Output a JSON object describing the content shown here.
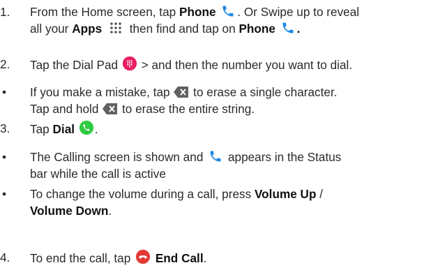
{
  "steps": {
    "s1": {
      "num": "1.",
      "l1a": "From the Home screen, tap ",
      "l1b": "Phone",
      "l1c": ". Or Swipe up to reveal",
      "l2a": "all your ",
      "l2b": "Apps",
      "l2c": " then find and tap on ",
      "l2d": "Phone",
      "l2e": "."
    },
    "s2": {
      "num": "2.",
      "a": "Tap the Dial Pad ",
      "b": " > and then the number you want to dial."
    },
    "b1": {
      "bullet": "•",
      "l1a": "If you make a mistake, tap ",
      "l1b": " to erase a single character.",
      "l2a": "Tap and hold ",
      "l2b": " to erase the entire string."
    },
    "s3": {
      "num": "3.",
      "a": "Tap ",
      "b": "Dial",
      "c": "."
    },
    "b2": {
      "bullet": "•",
      "l1a": "The Calling screen is shown and ",
      "l1b": " appears in the Status",
      "l2": "bar while the call is active"
    },
    "b3": {
      "bullet": "•",
      "l1a": "To change the volume during a call, press ",
      "l1b": "Volume Up",
      "l1c": " /",
      "l2a": "Volume Down",
      "l2b": "."
    },
    "s4": {
      "num": "4.",
      "a": "To end the call, tap ",
      "b": "End Call",
      "c": "."
    }
  },
  "icons": {
    "phone": "phone-icon",
    "apps": "apps-grid-icon",
    "dialpad": "dial-pad-icon",
    "backspace": "backspace-icon",
    "dial": "dial-button-icon",
    "end_call": "end-call-icon"
  },
  "colors": {
    "phone_blue": "#1e88e5",
    "dialpad_pink": "#e91e63",
    "dial_green": "#2ecc40",
    "end_red": "#e53935",
    "text": "#2b2b2b",
    "icon_gray": "#616161"
  }
}
